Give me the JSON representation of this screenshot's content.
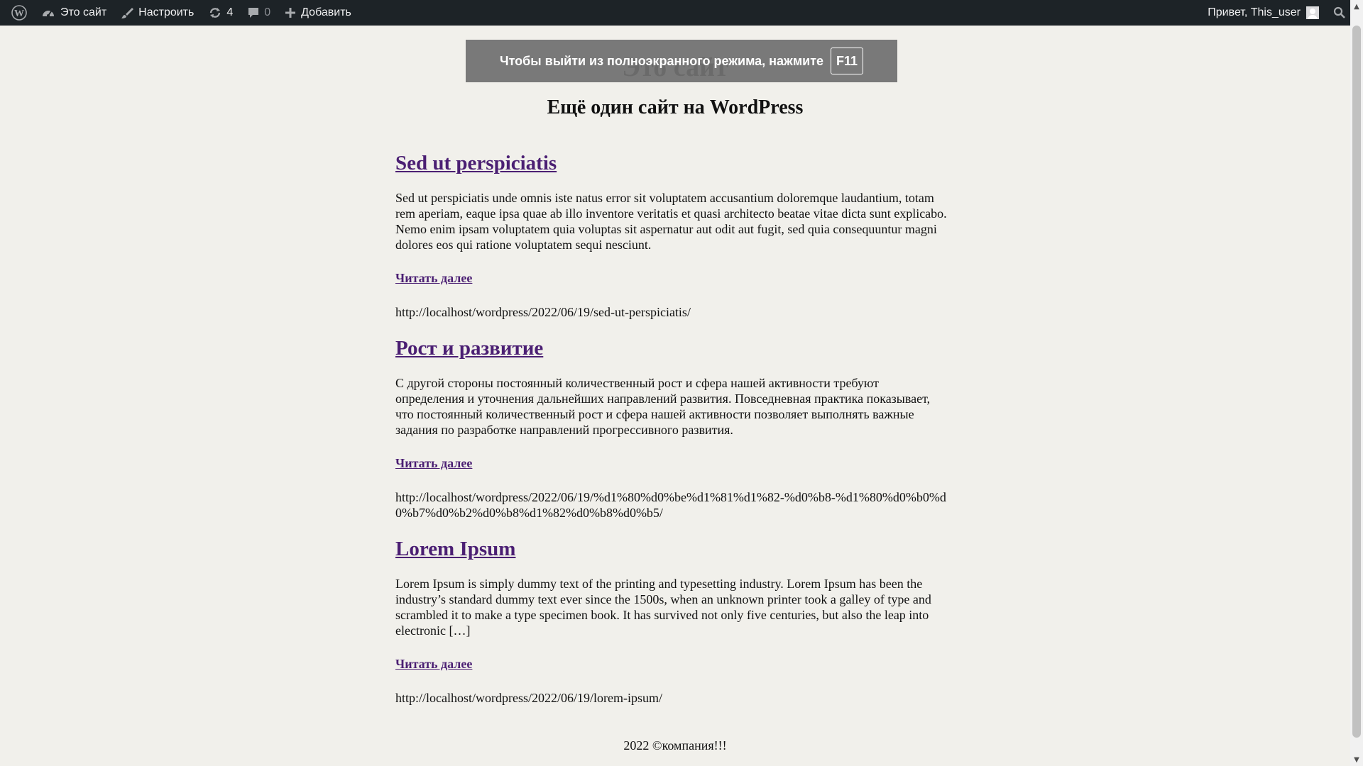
{
  "admin_bar": {
    "site_name": "Это сайт",
    "customize": "Настроить",
    "updates_count": "4",
    "comments_count": "0",
    "add_new": "Добавить",
    "greeting": "Привет, This_user"
  },
  "site": {
    "title": "Это сайт",
    "description": "Ещё один сайт на WordPress"
  },
  "posts": [
    {
      "title": "Sed ut perspiciatis",
      "excerpt": "Sed ut perspiciatis unde omnis iste natus error sit voluptatem accusantium doloremque laudantium, totam rem aperiam, eaque ipsa quae ab illo inventore veritatis et quasi architecto beatae vitae dicta sunt explicabo. Nemo enim ipsam voluptatem quia voluptas sit aspernatur aut odit aut fugit, sed quia consequuntur magni dolores eos qui ratione voluptatem sequi nesciunt.",
      "read_more": "Читать далее",
      "url": "http://localhost/wordpress/2022/06/19/sed-ut-perspiciatis/"
    },
    {
      "title": "Рост и развитие",
      "excerpt": "С другой стороны постоянный количественный рост и сфера нашей активности требуют определения и уточнения дальнейших направлений развития. Повседневная практика показывает, что постоянный количественный рост и сфера нашей активности позволяет выполнять важные задания по разработке направлений прогрессивного развития.",
      "read_more": "Читать далее",
      "url": "http://localhost/wordpress/2022/06/19/%d1%80%d0%be%d1%81%d1%82-%d0%b8-%d1%80%d0%b0%d0%b7%d0%b2%d0%b8%d1%82%d0%b8%d0%b5/"
    },
    {
      "title": "Lorem Ipsum",
      "excerpt": "Lorem Ipsum is simply dummy text of the printing and typesetting industry. Lorem Ipsum has been the industry’s standard dummy text ever since the 1500s, when an unknown printer took a galley of type and scrambled it to make a type specimen book. It has survived not only five centuries, but also the leap into electronic […]",
      "read_more": "Читать далее",
      "url": "http://localhost/wordpress/2022/06/19/lorem-ipsum/"
    }
  ],
  "footer": {
    "text": "2022 ©компания!!!"
  },
  "fullscreen_notice": {
    "text": "Чтобы выйти из полноэкранного режима, нажмите",
    "key": "F11"
  },
  "colors": {
    "admin_bar_bg": "#1d2327",
    "page_bg": "#f1f0eb",
    "link": "#4b1f73"
  }
}
